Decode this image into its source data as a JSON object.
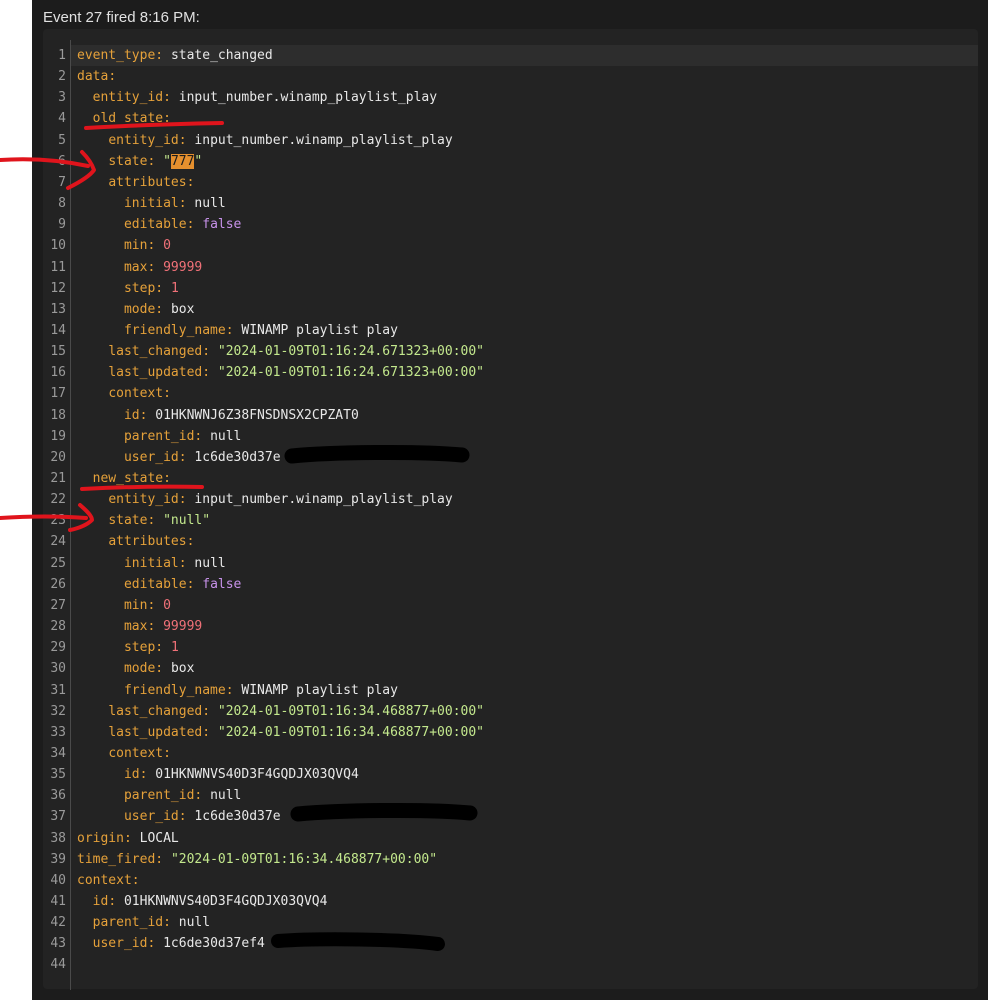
{
  "event_title": "Event 27 fired 8:16 PM:",
  "yaml_lines": [
    {
      "n": "1",
      "indent": "",
      "key": "event_type",
      "value": "state_changed",
      "type": "plain"
    },
    {
      "n": "2",
      "indent": "",
      "key": "data",
      "value": "",
      "type": "plain"
    },
    {
      "n": "3",
      "indent": "  ",
      "key": "entity_id",
      "value": "input_number.winamp_playlist_play",
      "type": "plain"
    },
    {
      "n": "4",
      "indent": "  ",
      "key": "old_state",
      "value": "",
      "type": "plain"
    },
    {
      "n": "5",
      "indent": "    ",
      "key": "entity_id",
      "value": "input_number.winamp_playlist_play",
      "type": "plain"
    },
    {
      "n": "6",
      "indent": "    ",
      "key": "state",
      "value": "777",
      "type": "highlight"
    },
    {
      "n": "7",
      "indent": "    ",
      "key": "attributes",
      "value": "",
      "type": "plain"
    },
    {
      "n": "8",
      "indent": "      ",
      "key": "initial",
      "value": "null",
      "type": "plain"
    },
    {
      "n": "9",
      "indent": "      ",
      "key": "editable",
      "value": "false",
      "type": "bool"
    },
    {
      "n": "10",
      "indent": "      ",
      "key": "min",
      "value": "0",
      "type": "number"
    },
    {
      "n": "11",
      "indent": "      ",
      "key": "max",
      "value": "99999",
      "type": "number"
    },
    {
      "n": "12",
      "indent": "      ",
      "key": "step",
      "value": "1",
      "type": "number"
    },
    {
      "n": "13",
      "indent": "      ",
      "key": "mode",
      "value": "box",
      "type": "plain"
    },
    {
      "n": "14",
      "indent": "      ",
      "key": "friendly_name",
      "value": "WINAMP playlist play",
      "type": "plain"
    },
    {
      "n": "15",
      "indent": "    ",
      "key": "last_changed",
      "value": "\"2024-01-09T01:16:24.671323+00:00\"",
      "type": "string"
    },
    {
      "n": "16",
      "indent": "    ",
      "key": "last_updated",
      "value": "\"2024-01-09T01:16:24.671323+00:00\"",
      "type": "string"
    },
    {
      "n": "17",
      "indent": "    ",
      "key": "context",
      "value": "",
      "type": "plain"
    },
    {
      "n": "18",
      "indent": "      ",
      "key": "id",
      "value": "01HKNWNJ6Z38FNSDNSX2CPZAT0",
      "type": "plain"
    },
    {
      "n": "19",
      "indent": "      ",
      "key": "parent_id",
      "value": "null",
      "type": "plain"
    },
    {
      "n": "20",
      "indent": "      ",
      "key": "user_id",
      "value": "1c6de30d37e",
      "type": "plain"
    },
    {
      "n": "21",
      "indent": "  ",
      "key": "new_state",
      "value": "",
      "type": "plain"
    },
    {
      "n": "22",
      "indent": "    ",
      "key": "entity_id",
      "value": "input_number.winamp_playlist_play",
      "type": "plain"
    },
    {
      "n": "23",
      "indent": "    ",
      "key": "state",
      "value": "\"null\"",
      "type": "string"
    },
    {
      "n": "24",
      "indent": "    ",
      "key": "attributes",
      "value": "",
      "type": "plain"
    },
    {
      "n": "25",
      "indent": "      ",
      "key": "initial",
      "value": "null",
      "type": "plain"
    },
    {
      "n": "26",
      "indent": "      ",
      "key": "editable",
      "value": "false",
      "type": "bool"
    },
    {
      "n": "27",
      "indent": "      ",
      "key": "min",
      "value": "0",
      "type": "number"
    },
    {
      "n": "28",
      "indent": "      ",
      "key": "max",
      "value": "99999",
      "type": "number"
    },
    {
      "n": "29",
      "indent": "      ",
      "key": "step",
      "value": "1",
      "type": "number"
    },
    {
      "n": "30",
      "indent": "      ",
      "key": "mode",
      "value": "box",
      "type": "plain"
    },
    {
      "n": "31",
      "indent": "      ",
      "key": "friendly_name",
      "value": "WINAMP playlist play",
      "type": "plain"
    },
    {
      "n": "32",
      "indent": "    ",
      "key": "last_changed",
      "value": "\"2024-01-09T01:16:34.468877+00:00\"",
      "type": "string"
    },
    {
      "n": "33",
      "indent": "    ",
      "key": "last_updated",
      "value": "\"2024-01-09T01:16:34.468877+00:00\"",
      "type": "string"
    },
    {
      "n": "34",
      "indent": "    ",
      "key": "context",
      "value": "",
      "type": "plain"
    },
    {
      "n": "35",
      "indent": "      ",
      "key": "id",
      "value": "01HKNWNVS40D3F4GQDJX03QVQ4",
      "type": "plain"
    },
    {
      "n": "36",
      "indent": "      ",
      "key": "parent_id",
      "value": "null",
      "type": "plain"
    },
    {
      "n": "37",
      "indent": "      ",
      "key": "user_id",
      "value": "1c6de30d37e",
      "type": "plain"
    },
    {
      "n": "38",
      "indent": "",
      "key": "origin",
      "value": "LOCAL",
      "type": "plain"
    },
    {
      "n": "39",
      "indent": "",
      "key": "time_fired",
      "value": "\"2024-01-09T01:16:34.468877+00:00\"",
      "type": "string"
    },
    {
      "n": "40",
      "indent": "",
      "key": "context",
      "value": "",
      "type": "plain"
    },
    {
      "n": "41",
      "indent": "  ",
      "key": "id",
      "value": "01HKNWNVS40D3F4GQDJX03QVQ4",
      "type": "plain"
    },
    {
      "n": "42",
      "indent": "  ",
      "key": "parent_id",
      "value": "null",
      "type": "plain"
    },
    {
      "n": "43",
      "indent": "  ",
      "key": "user_id",
      "value": "1c6de30d37ef4",
      "type": "plain"
    },
    {
      "n": "44",
      "indent": "",
      "key": "",
      "value": "",
      "type": "empty"
    }
  ],
  "colors": {
    "key": "#e5a13a",
    "string": "#c3e88d",
    "number": "#f07178",
    "bool": "#c792ea",
    "highlight_bg": "#e6902e",
    "annotation": "#e0141c",
    "redaction": "#000000"
  }
}
